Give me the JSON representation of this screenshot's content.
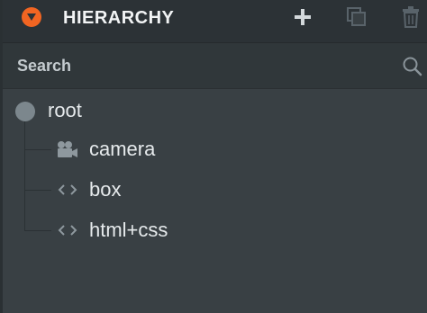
{
  "header": {
    "title": "HIERARCHY",
    "collapse_icon": "chevron-down-icon",
    "accent_color": "#f26522",
    "actions": [
      {
        "name": "add",
        "icon": "plus-icon"
      },
      {
        "name": "duplicate",
        "icon": "copy-icon"
      },
      {
        "name": "delete",
        "icon": "trash-icon"
      }
    ]
  },
  "search": {
    "placeholder": "Search",
    "value": "",
    "icon": "search-icon"
  },
  "tree": {
    "root": {
      "label": "root",
      "icon": "entity-dot-icon"
    },
    "children": [
      {
        "label": "camera",
        "icon": "camera-icon"
      },
      {
        "label": "box",
        "icon": "code-brackets-icon"
      },
      {
        "label": "html+css",
        "icon": "code-brackets-icon"
      }
    ]
  }
}
